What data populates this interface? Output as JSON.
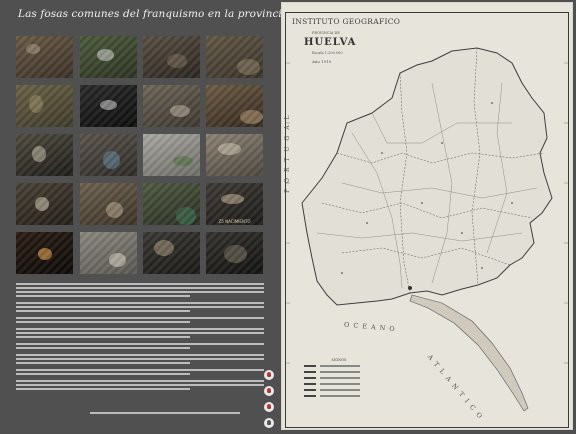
{
  "poster": {
    "title": "Las fosas comunes del franquismo en la provincia de Huelva"
  },
  "photos": [
    {
      "name": "photo-excavation-site",
      "c1": "#6a5a45",
      "c2": "#3c3128",
      "accent": "#a89a86"
    },
    {
      "name": "photo-grave-outline",
      "c1": "#4c5a3c",
      "c2": "#2d3422",
      "accent": "#d8d8d8"
    },
    {
      "name": "photo-workers-in-trench",
      "c1": "#5a4f43",
      "c2": "#2b2620",
      "accent": "#7d6e5c"
    },
    {
      "name": "photo-pit-with-people",
      "c1": "#625846",
      "c2": "#3a3329",
      "accent": "#8c8067"
    },
    {
      "name": "photo-field-grass",
      "c1": "#6b6146",
      "c2": "#3f3b2a",
      "accent": "#9b8e67"
    },
    {
      "name": "photo-dark-doorway",
      "c1": "#2a2a2a",
      "c2": "#0e0e0e",
      "accent": "#d9d9d9"
    },
    {
      "name": "photo-bones-in-soil",
      "c1": "#6e6658",
      "c2": "#3d3831",
      "accent": "#bdb3a0"
    },
    {
      "name": "photo-hands-cleaning-bones",
      "c1": "#6d5b45",
      "c2": "#34291e",
      "accent": "#b79a74"
    },
    {
      "name": "photo-skull-with-scale",
      "c1": "#4f4b3f",
      "c2": "#1f1d18",
      "accent": "#c7bfae"
    },
    {
      "name": "photo-bottles-in-ground",
      "c1": "#5b544b",
      "c2": "#2e2b27",
      "accent": "#6a8aa0"
    },
    {
      "name": "photo-misty-field-sign",
      "c1": "#a9a7a1",
      "c2": "#6f6f68",
      "accent": "#4c6e3c"
    },
    {
      "name": "photo-bones-close-up",
      "c1": "#8c8375",
      "c2": "#4f483f",
      "accent": "#cfc6b5"
    },
    {
      "name": "photo-skulls-row",
      "c1": "#4a4136",
      "c2": "#231e18",
      "accent": "#d6cdb8"
    },
    {
      "name": "photo-skeleton-remains",
      "c1": "#6e6250",
      "c2": "#3c3327",
      "accent": "#b8a98d"
    },
    {
      "name": "photo-team-with-green-box",
      "c1": "#4f5a42",
      "c2": "#2a2f23",
      "accent": "#3f7a5a"
    },
    {
      "name": "photo-skull-with-label",
      "c1": "#3e3a35",
      "c2": "#1d1b18",
      "accent": "#c9b89c"
    },
    {
      "name": "photo-lamp-in-dark",
      "c1": "#2a1d14",
      "c2": "#0d0a08",
      "accent": "#ffb05a"
    },
    {
      "name": "photo-hand-bones-tray",
      "c1": "#8b887f",
      "c2": "#5a5852",
      "accent": "#e0d8c8"
    },
    {
      "name": "photo-bone-fragments",
      "c1": "#3a3833",
      "c2": "#1a1917",
      "accent": "#a8977c"
    },
    {
      "name": "photo-bones-pile",
      "c1": "#34322e",
      "c2": "#121210",
      "accent": "#7a7262"
    }
  ],
  "photo_captions": {
    "photo_16": "Z5 NACIMIENTO"
  },
  "map": {
    "institute": "INSTITUTO GEOGRAFICO",
    "province_label": "PROVINCIA DE",
    "province": "HUELVA",
    "scale": "Escala 1:200.000",
    "year": "Año 1910",
    "sea_label": "OCEANO",
    "ocean_label_2": "ATLANTICO",
    "country_label": "PORTUGAL",
    "legend_title": "SIGNOS"
  },
  "colors": {
    "background": "#505050",
    "map_paper": "#e7e4dc",
    "text_light": "#f2f2f2"
  }
}
